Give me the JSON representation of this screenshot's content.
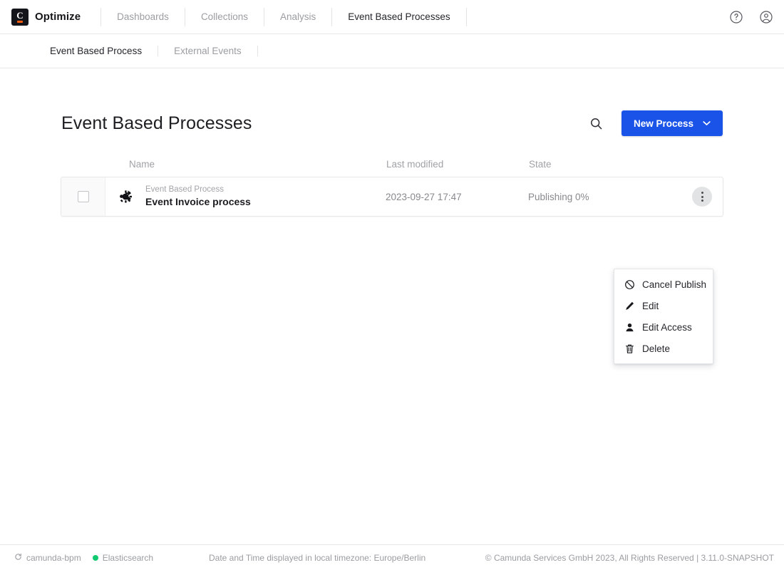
{
  "header": {
    "brand_name": "Optimize",
    "logo_letter": "C",
    "nav_items": [
      {
        "label": "Dashboards",
        "active": false
      },
      {
        "label": "Collections",
        "active": false
      },
      {
        "label": "Analysis",
        "active": false
      },
      {
        "label": "Event Based Processes",
        "active": true
      }
    ],
    "help_icon": "help-circle-icon",
    "user_icon": "user-avatar-icon"
  },
  "subnav": {
    "items": [
      {
        "label": "Event Based Process",
        "active": true
      },
      {
        "label": "External Events",
        "active": false
      }
    ]
  },
  "page": {
    "title": "Event Based Processes",
    "search_icon": "search-icon",
    "new_process_label": "New Process",
    "new_process_caret": "chevron-down-icon",
    "accent_color": "#1a53e8"
  },
  "table": {
    "columns": [
      "Name",
      "Last modified",
      "State"
    ],
    "rows": [
      {
        "checked": false,
        "icon": "event-process-gear-icon",
        "type_label": "Event Based Process",
        "name": "Event Invoice process",
        "last_modified": "2023-09-27 17:47",
        "state": "Publishing 0%",
        "menu_icon": "kebab-menu-icon"
      }
    ]
  },
  "context_menu": {
    "open": true,
    "items": [
      {
        "label": "Cancel Publish",
        "icon": "ban-icon"
      },
      {
        "label": "Edit",
        "icon": "pencil-icon"
      },
      {
        "label": "Edit Access",
        "icon": "person-icon"
      },
      {
        "label": "Delete",
        "icon": "trash-icon"
      }
    ]
  },
  "footer": {
    "engine_status": "camunda-bpm",
    "engine_icon": "refresh-icon",
    "search_engine_status": "Elasticsearch",
    "search_engine_dot_color": "#10c971",
    "timezone_note": "Date and Time displayed in local timezone: Europe/Berlin",
    "copyright": "© Camunda Services GmbH 2023, All Rights Reserved | 3.11.0-SNAPSHOT"
  }
}
